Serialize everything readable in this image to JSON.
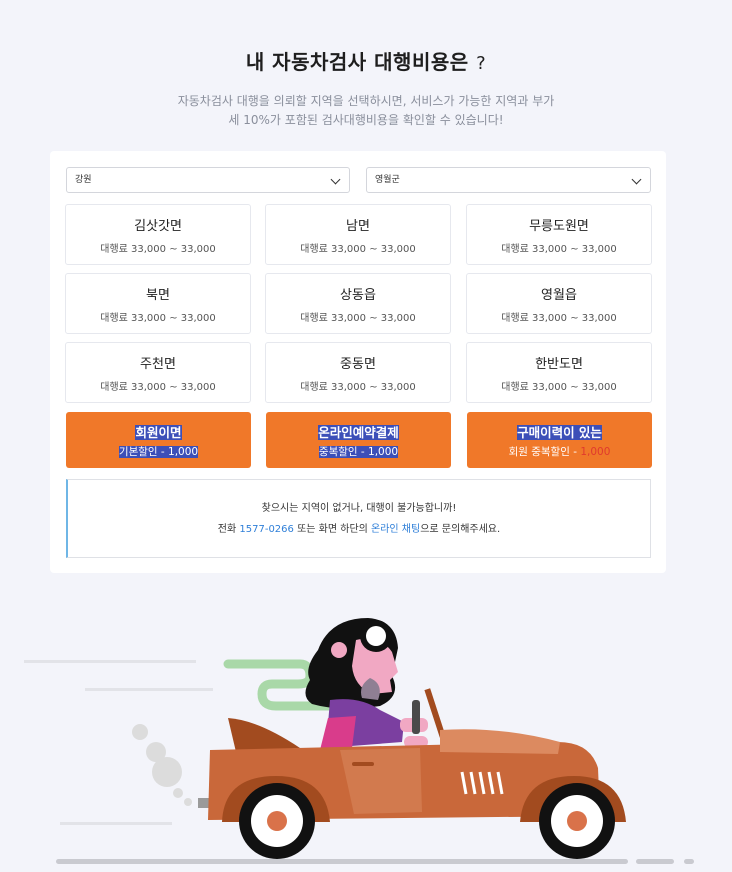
{
  "header": {
    "title": "내 자동차검사 대행비용은",
    "title_mark": "?",
    "subtitle_line1": "자동차검사 대행을 의뢰할 지역을 선택하시면, 서비스가 가능한 지역과 부가",
    "subtitle_line2": "세 10%가 포함된 검사대행비용을 확인할 수 있습니다!"
  },
  "filters": {
    "province": "강원",
    "county": "영월군"
  },
  "regions": [
    {
      "name": "김삿갓면",
      "fee": "대행료 33,000 ~ 33,000"
    },
    {
      "name": "남면",
      "fee": "대행료 33,000 ~ 33,000"
    },
    {
      "name": "무릉도원면",
      "fee": "대행료 33,000 ~ 33,000"
    },
    {
      "name": "북면",
      "fee": "대행료 33,000 ~ 33,000"
    },
    {
      "name": "상동읍",
      "fee": "대행료 33,000 ~ 33,000"
    },
    {
      "name": "영월읍",
      "fee": "대행료 33,000 ~ 33,000"
    },
    {
      "name": "주천면",
      "fee": "대행료 33,000 ~ 33,000"
    },
    {
      "name": "중동면",
      "fee": "대행료 33,000 ~ 33,000"
    },
    {
      "name": "한반도면",
      "fee": "대행료 33,000 ~ 33,000"
    }
  ],
  "promos": [
    {
      "title": "회원이면",
      "desc": "기본할인 - 1,000"
    },
    {
      "title": "온라인예약결제",
      "desc": "중복할인 - 1,000"
    },
    {
      "title": "구매이력이 있는",
      "desc_prefix": "회원 중복할인 - ",
      "desc_amount": "1,000"
    }
  ],
  "notice": {
    "line1": "찾으시는 지역이 없거나, 대행이 불가능합니까!",
    "line2_a": "전화 ",
    "phone": "1577-0266",
    "line2_b": " 또는 화면 하단의 ",
    "chat": "온라인 채팅",
    "line2_c": "으로 문의해주세요."
  },
  "colors": {
    "accent_orange": "#f07829",
    "highlight": "#3c4fb8",
    "link": "#2f7fd8",
    "notice_border": "#6fb6e6"
  },
  "illustration": "woman-driving-car-illustration"
}
